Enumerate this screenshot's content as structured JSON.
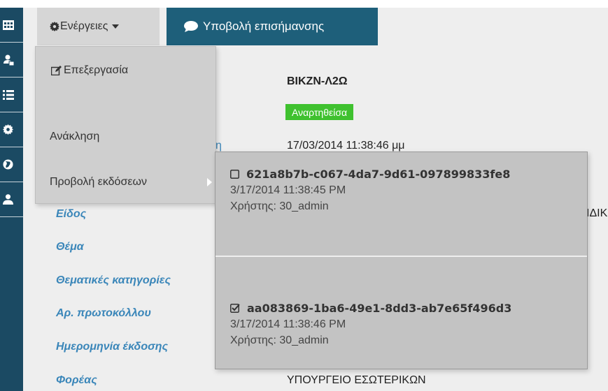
{
  "toolbar": {
    "actions_label": "Ενέργειες",
    "report_label": "Υποβολή επισήμανσης"
  },
  "sidebar": {
    "items": [
      {
        "icon": "table-icon"
      },
      {
        "icon": "users-icon"
      },
      {
        "icon": "list-icon"
      },
      {
        "icon": "gear-icon"
      },
      {
        "icon": "globe-icon"
      },
      {
        "icon": "user-icon"
      }
    ]
  },
  "document": {
    "title": "ΒΙΚΖΝ-Λ2Ω",
    "status": "Αναρτηθείσα",
    "date_value": "17/03/2014 11:38:46 μμ",
    "link_fragment": "η",
    "peek_fragment": "ΙΔΙΚ",
    "fields": [
      {
        "label": "Είδος"
      },
      {
        "label": "Θέμα"
      },
      {
        "label": "Θεματικές κατηγορίες"
      },
      {
        "label": "Αρ. πρωτοκόλλου"
      },
      {
        "label": "Ημερομηνία έκδοσης"
      },
      {
        "label": "Φορέας",
        "value": "ΥΠΟΥΡΓΕΙΟ ΕΣΩΤΕΡΙΚΩΝ"
      }
    ]
  },
  "dropdown": {
    "edit_label": "Επεξεργασία",
    "revoke_label": "Ανάκληση",
    "versions_label": "Προβολή εκδόσεων"
  },
  "versions": [
    {
      "id": "621a8b7b-c067-4da7-9d61-097899833fe8",
      "date": "3/17/2014 11:38:45 PM",
      "user": "Χρήστης: 30_admin",
      "checked": false
    },
    {
      "id": "aa083869-1ba6-49e1-8dd3-ab7e65f496d3",
      "date": "3/17/2014 11:38:46 PM",
      "user": "Χρήστης: 30_admin",
      "checked": true
    }
  ],
  "colors": {
    "sidebar": "#1b4a63",
    "primary_button": "#1e5f7a",
    "label": "#3a86b9",
    "status": "#3fc12f"
  }
}
